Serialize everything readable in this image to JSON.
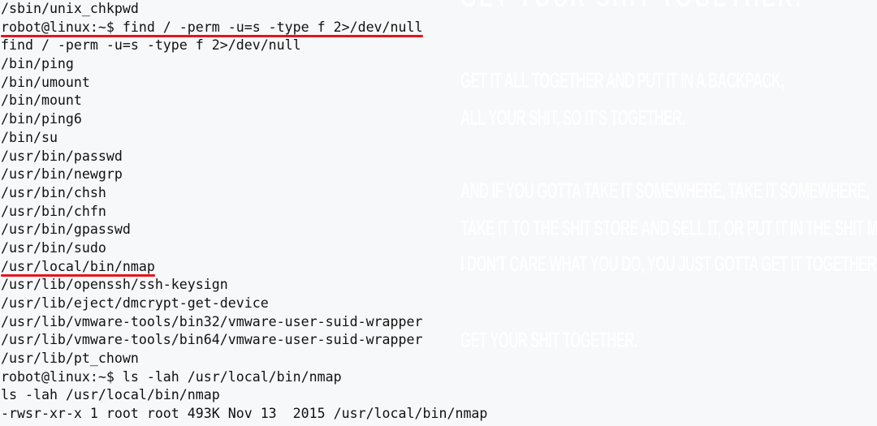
{
  "theme": {
    "background": "#f7f8fa",
    "text": "#111111",
    "highlight_underline": "#e8141b"
  },
  "watermark": {
    "title": "Get your shit together.",
    "lines": [
      "Get it all together and put it in a backpack,",
      "all your shit, so it's together.",
      "And if you gotta take it somewhere, take it somewhere,",
      "take it to the shit store and sell it, or put it in the shit museum,",
      "I don't care what you do, you just gotta get it together.",
      "Get your shit together."
    ]
  },
  "terminal": {
    "lines": [
      {
        "text": "/sbin/unix_chkpwd",
        "kind": "output",
        "highlighted": false
      },
      {
        "text": "robot@linux:~$ find / -perm -u=s -type f 2>/dev/null",
        "kind": "prompt",
        "highlighted": true
      },
      {
        "text": "find / -perm -u=s -type f 2>/dev/null",
        "kind": "echo",
        "highlighted": false
      },
      {
        "text": "/bin/ping",
        "kind": "output",
        "highlighted": false
      },
      {
        "text": "/bin/umount",
        "kind": "output",
        "highlighted": false
      },
      {
        "text": "/bin/mount",
        "kind": "output",
        "highlighted": false
      },
      {
        "text": "/bin/ping6",
        "kind": "output",
        "highlighted": false
      },
      {
        "text": "/bin/su",
        "kind": "output",
        "highlighted": false
      },
      {
        "text": "/usr/bin/passwd",
        "kind": "output",
        "highlighted": false
      },
      {
        "text": "/usr/bin/newgrp",
        "kind": "output",
        "highlighted": false
      },
      {
        "text": "/usr/bin/chsh",
        "kind": "output",
        "highlighted": false
      },
      {
        "text": "/usr/bin/chfn",
        "kind": "output",
        "highlighted": false
      },
      {
        "text": "/usr/bin/gpasswd",
        "kind": "output",
        "highlighted": false
      },
      {
        "text": "/usr/bin/sudo",
        "kind": "output",
        "highlighted": false
      },
      {
        "text": "/usr/local/bin/nmap",
        "kind": "output",
        "highlighted": true
      },
      {
        "text": "/usr/lib/openssh/ssh-keysign",
        "kind": "output",
        "highlighted": false
      },
      {
        "text": "/usr/lib/eject/dmcrypt-get-device",
        "kind": "output",
        "highlighted": false
      },
      {
        "text": "/usr/lib/vmware-tools/bin32/vmware-user-suid-wrapper",
        "kind": "output",
        "highlighted": false
      },
      {
        "text": "/usr/lib/vmware-tools/bin64/vmware-user-suid-wrapper",
        "kind": "output",
        "highlighted": false
      },
      {
        "text": "/usr/lib/pt_chown",
        "kind": "output",
        "highlighted": false
      },
      {
        "text": "robot@linux:~$ ls -lah /usr/local/bin/nmap",
        "kind": "prompt",
        "highlighted": false
      },
      {
        "text": "ls -lah /usr/local/bin/nmap",
        "kind": "echo",
        "highlighted": false
      },
      {
        "text": "-rwsr-xr-x 1 root root 493K Nov 13  2015 /usr/local/bin/nmap",
        "kind": "output",
        "highlighted": false
      }
    ]
  }
}
